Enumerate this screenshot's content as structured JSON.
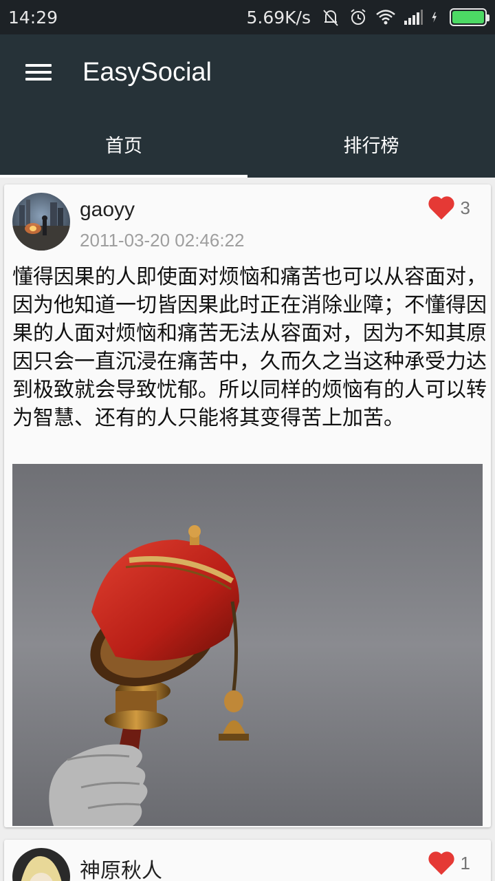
{
  "status_bar": {
    "time": "14:29",
    "net_speed": "5.69K/s",
    "icons": [
      "mute-bell-icon",
      "alarm-icon",
      "wifi-icon",
      "signal-icon",
      "charging-icon",
      "battery-icon"
    ]
  },
  "app_bar": {
    "title": "EasySocial",
    "menu_icon": "hamburger-menu-icon"
  },
  "tabs": [
    {
      "label": "首页",
      "active": true
    },
    {
      "label": "排行榜",
      "active": false
    }
  ],
  "colors": {
    "app_bar": "#263238",
    "status_bar": "#1d2226",
    "like_heart": "#e53935",
    "background": "#eeeeee"
  },
  "posts": [
    {
      "username": "gaoyy",
      "timestamp": "2011-03-20 02:46:22",
      "likes": "3",
      "text": "懂得因果的人即使面对烦恼和痛苦也可以从容面对，因为他知道一切皆因果此时正在消除业障；不懂得因果的人面对烦恼和痛苦无法从容面对，因为不知其原因只会一直沉浸在痛苦中，久而久之当这种承受力达到极致就会导致忧郁。所以同样的烦恼有的人可以转为智慧、还有的人只能将其变得苦上加苦。",
      "image": "prayer-wheel-photo"
    },
    {
      "username": "神原秋人",
      "likes": "1"
    }
  ]
}
